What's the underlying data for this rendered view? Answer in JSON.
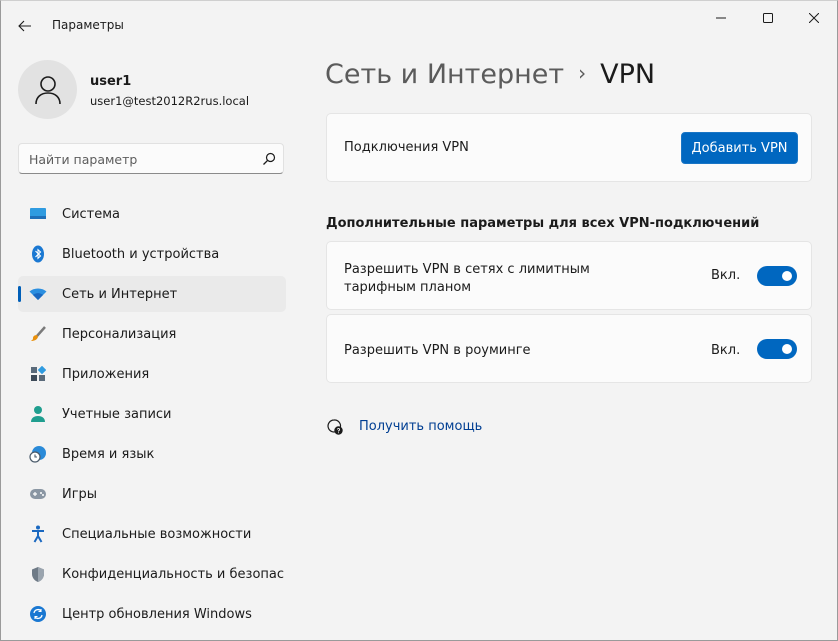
{
  "window": {
    "title": "Параметры"
  },
  "profile": {
    "name": "user1",
    "email": "user1@test2012R2rus.local"
  },
  "search": {
    "placeholder": "Найти параметр"
  },
  "sidebar": {
    "items": [
      {
        "label": "Система",
        "icon": "system-icon"
      },
      {
        "label": "Bluetooth и устройства",
        "icon": "bluetooth-icon"
      },
      {
        "label": "Сеть и Интернет",
        "icon": "wifi-icon",
        "active": true
      },
      {
        "label": "Персонализация",
        "icon": "brush-icon"
      },
      {
        "label": "Приложения",
        "icon": "apps-icon"
      },
      {
        "label": "Учетные записи",
        "icon": "account-icon"
      },
      {
        "label": "Время и язык",
        "icon": "globe-clock-icon"
      },
      {
        "label": "Игры",
        "icon": "gamepad-icon"
      },
      {
        "label": "Специальные возможности",
        "icon": "accessibility-icon"
      },
      {
        "label": "Конфиденциальность и безопас",
        "icon": "shield-icon"
      },
      {
        "label": "Центр обновления Windows",
        "icon": "update-icon"
      }
    ]
  },
  "breadcrumb": {
    "parent": "Сеть и Интернет",
    "separator": "›",
    "current": "VPN"
  },
  "vpn_connections": {
    "label": "Подключения VPN",
    "add_button": "Добавить VPN"
  },
  "advanced": {
    "title": "Дополнительные параметры для всех VPN-подключений",
    "settings": [
      {
        "line1": "Разрешить VPN в сетях с лимитным",
        "line2": "тарифным планом",
        "state": "Вкл.",
        "on": true
      },
      {
        "line1": "Разрешить VPN в роуминге",
        "state": "Вкл.",
        "on": true
      }
    ]
  },
  "help": {
    "label": "Получить помощь"
  },
  "colors": {
    "accent": "#0067c0",
    "background": "#f3f3f3",
    "card": "#fbfbfb",
    "link": "#003e92"
  }
}
